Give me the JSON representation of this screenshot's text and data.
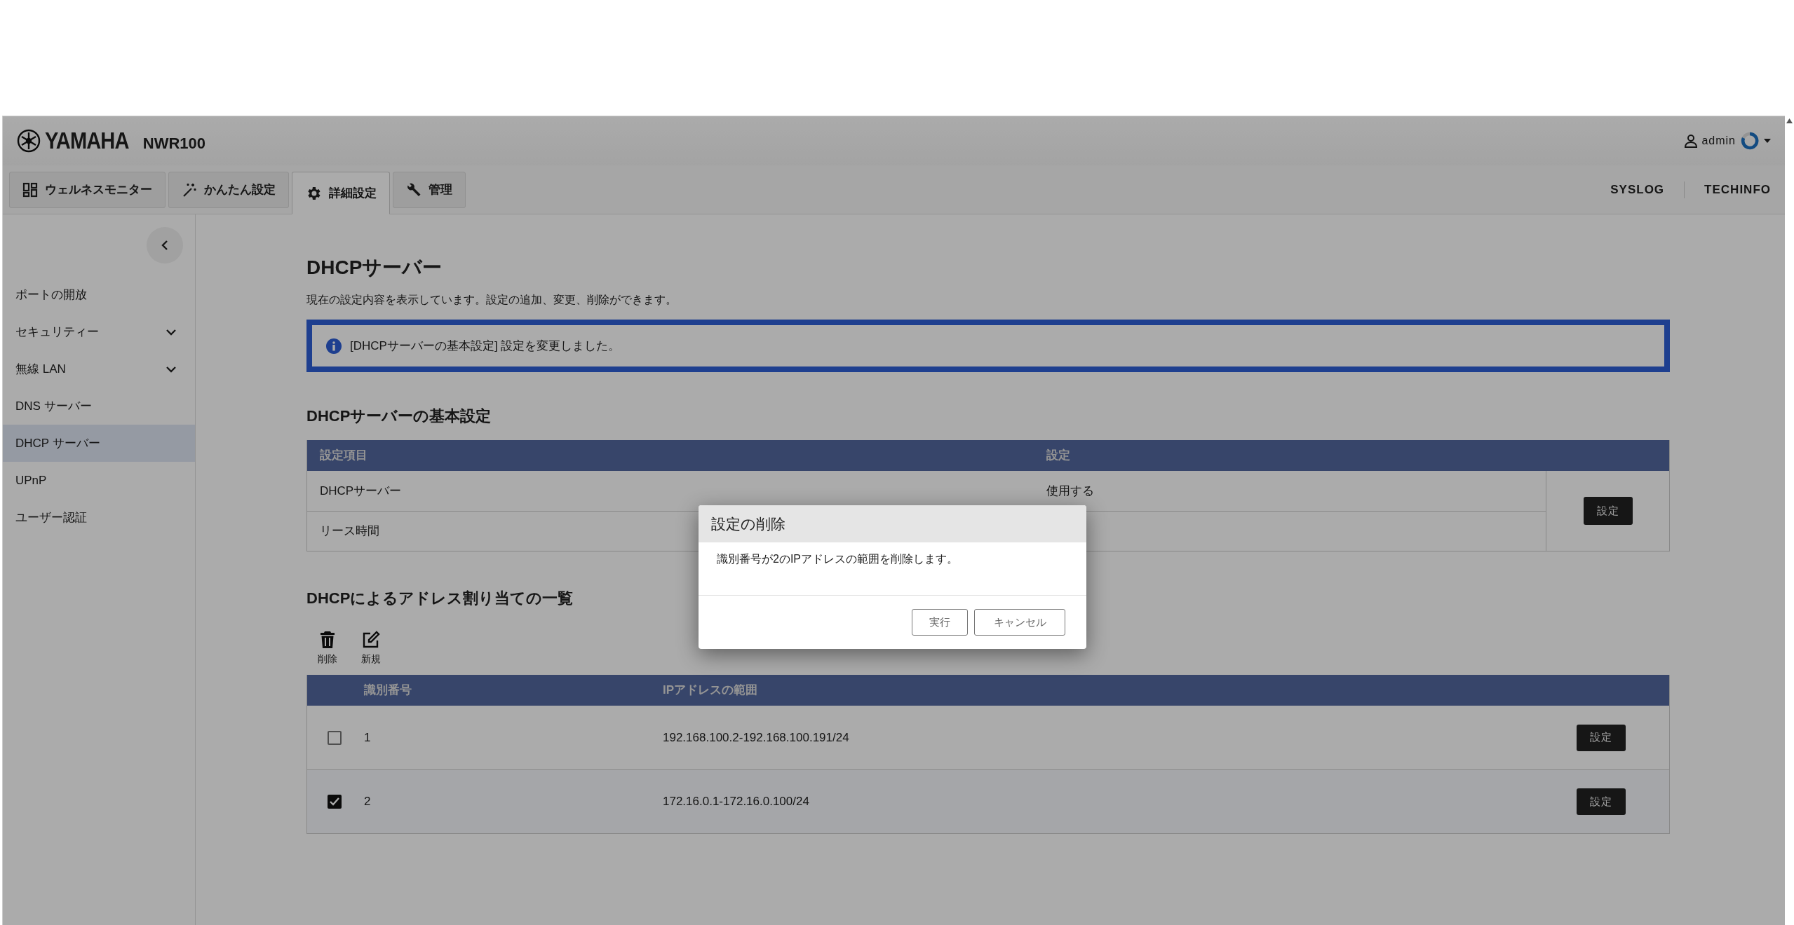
{
  "header": {
    "brand": "YAMAHA",
    "model": "NWR100",
    "user": "admin"
  },
  "tabs": [
    {
      "label": "ウェルネスモニター",
      "selected": false
    },
    {
      "label": "かんたん設定",
      "selected": false
    },
    {
      "label": "詳細設定",
      "selected": true
    },
    {
      "label": "管理",
      "selected": false
    }
  ],
  "header_links": [
    "SYSLOG",
    "TECHINFO"
  ],
  "sidebar": {
    "items": [
      {
        "label": "ポートの開放",
        "kind": "link",
        "selected": false
      },
      {
        "label": "セキュリティー",
        "kind": "group",
        "selected": false
      },
      {
        "label": "無線 LAN",
        "kind": "group",
        "selected": false
      },
      {
        "label": "DNS サーバー",
        "kind": "link",
        "selected": false
      },
      {
        "label": "DHCP サーバー",
        "kind": "link",
        "selected": true
      },
      {
        "label": "UPnP",
        "kind": "link",
        "selected": false
      },
      {
        "label": "ユーザー認証",
        "kind": "link",
        "selected": false
      }
    ]
  },
  "page": {
    "title": "DHCPサーバー",
    "description": "現在の設定内容を表示しています。設定の追加、変更、削除ができます。",
    "alert": {
      "message": "[DHCPサーバーの基本設定] 設定を変更しました。"
    }
  },
  "basic_settings": {
    "title": "DHCPサーバーの基本設定",
    "columns": [
      "設定項目",
      "設定"
    ],
    "button": "設定",
    "rows": [
      {
        "item": "DHCPサーバー",
        "value": "使用する"
      },
      {
        "item": "リース時間"
      }
    ]
  },
  "assignments": {
    "title": "DHCPによるアドレス割り当ての一覧",
    "toolbar": [
      {
        "label": "削除"
      },
      {
        "label": "新規"
      }
    ],
    "columns": [
      "識別番号",
      "IPアドレスの範囲"
    ],
    "rows": [
      {
        "id": "1",
        "range": "192.168.100.2-192.168.100.191/24",
        "checked": false,
        "button": "設定"
      },
      {
        "id": "2",
        "range": "172.16.0.1-172.16.0.100/24",
        "checked": true,
        "button": "設定"
      }
    ]
  },
  "dialog": {
    "title": "設定の削除",
    "message": "識別番号が2のIPアドレスの範囲を削除します。",
    "buttons": [
      "実行",
      "キャンセル"
    ]
  }
}
